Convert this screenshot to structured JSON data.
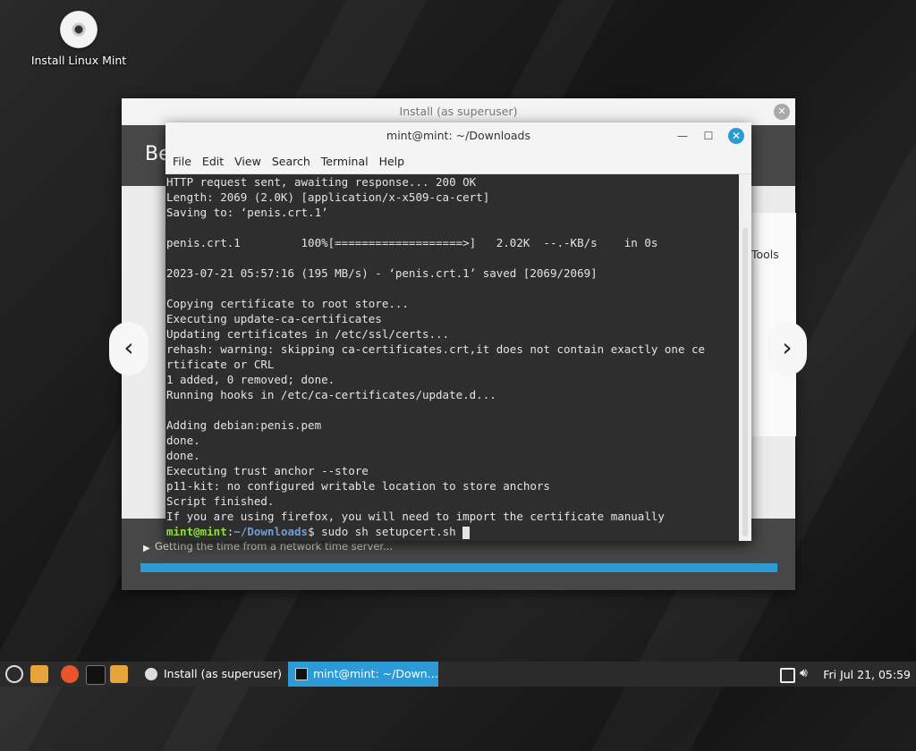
{
  "desktop": {
    "icon_label": "Install Linux Mint"
  },
  "installer": {
    "title": "Install (as superuser)",
    "banner_text": "Be",
    "slide_tools_label": "Tools",
    "status_text": "Getting the time from a network time server...",
    "progress": 1.0
  },
  "terminal": {
    "title": "mint@mint: ~/Downloads",
    "menu": [
      "File",
      "Edit",
      "View",
      "Search",
      "Terminal",
      "Help"
    ],
    "lines": [
      "HTTP request sent, awaiting response... 200 OK",
      "Length: 2069 (2.0K) [application/x-x509-ca-cert]",
      "Saving to: ‘penis.crt.1’",
      "",
      "penis.crt.1         100%[===================>]   2.02K  --.-KB/s    in 0s",
      "",
      "2023-07-21 05:57:16 (195 MB/s) - ‘penis.crt.1’ saved [2069/2069]",
      "",
      "Copying certificate to root store...",
      "Executing update-ca-certificates",
      "Updating certificates in /etc/ssl/certs...",
      "rehash: warning: skipping ca-certificates.crt,it does not contain exactly one ce",
      "rtificate or CRL",
      "1 added, 0 removed; done.",
      "Running hooks in /etc/ca-certificates/update.d...",
      "",
      "Adding debian:penis.pem",
      "done.",
      "done.",
      "Executing trust anchor --store",
      "p11-kit: no configured writable location to store anchors",
      "Script finished.",
      "If you are using firefox, you will need to import the certificate manually"
    ],
    "prompt_user": "mint@mint",
    "prompt_sep": ":",
    "prompt_path": "~/Downloads",
    "prompt_symbol": "$ ",
    "command": "sudo sh setupcert.sh "
  },
  "taskbar": {
    "windows": [
      "Install (as superuser)",
      "mint@mint: ~/Down..."
    ],
    "clock": "Fri Jul 21, 05:59"
  },
  "colors": {
    "accent": "#2d9ad6",
    "prompt_user": "#8ae234",
    "prompt_path": "#729fcf"
  }
}
